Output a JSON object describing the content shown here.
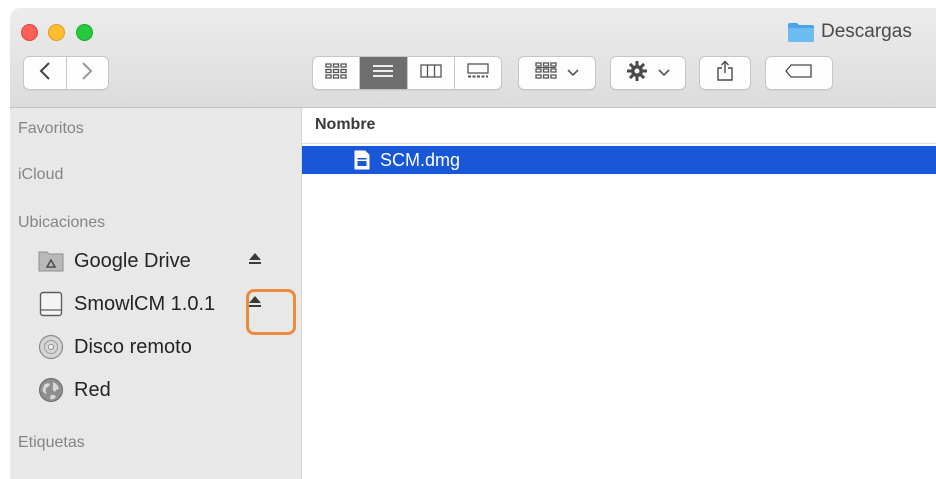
{
  "window": {
    "title": "Descargas"
  },
  "toolbar": {
    "back_icon": "chevron-left-icon",
    "forward_icon": "chevron-right-icon",
    "views": [
      "icon-view",
      "list-view",
      "column-view",
      "gallery-view"
    ],
    "active_view": "list-view",
    "arrange_icon": "grid-icon",
    "action_icon": "gear-icon",
    "share_icon": "share-icon",
    "tags_icon": "tag-icon"
  },
  "sidebar": {
    "favorites_header": "Favoritos",
    "icloud_header": "iCloud",
    "locations_header": "Ubicaciones",
    "locations": [
      {
        "label": "Google Drive",
        "icon": "google-drive-icon",
        "ejectable": true
      },
      {
        "label": "SmowlCM 1.0.1",
        "icon": "disk-icon",
        "ejectable": true,
        "highlighted": true
      },
      {
        "label": "Disco remoto",
        "icon": "optical-disc-icon",
        "ejectable": false
      },
      {
        "label": "Red",
        "icon": "network-globe-icon",
        "ejectable": false
      }
    ],
    "tags_header": "Etiquetas"
  },
  "file_list": {
    "column_name": "Nombre",
    "rows": [
      {
        "name": "SCM.dmg",
        "icon": "dmg-file-icon",
        "selected": true
      }
    ]
  },
  "colors": {
    "selection": "#1857d7",
    "highlight_outline": "#ec8a3e",
    "folder": "#4aa3e8",
    "sidebar_bg": "#e8e8e8"
  }
}
